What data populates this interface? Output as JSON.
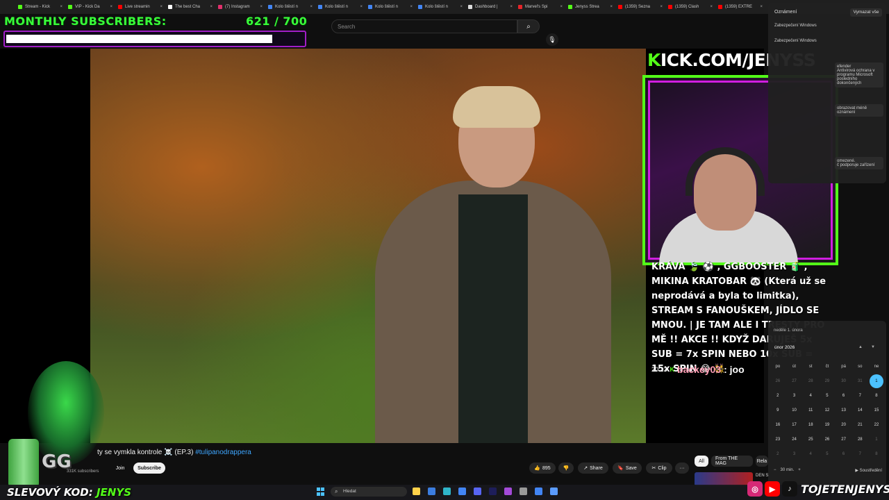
{
  "browser": {
    "tabs": [
      {
        "label": "Stream - Kick",
        "color": "#53fc18"
      },
      {
        "label": "VIP - Kick Da",
        "color": "#53fc18"
      },
      {
        "label": "Live streamin",
        "color": "#ff0000"
      },
      {
        "label": "The best Cha",
        "color": "#ffffff"
      },
      {
        "label": "(7) Instagram",
        "color": "#e1306c"
      },
      {
        "label": "Kolo štěstí n",
        "color": "#4285f4"
      },
      {
        "label": "Kolo štěstí n",
        "color": "#4285f4"
      },
      {
        "label": "Kolo štěstí n",
        "color": "#4285f4"
      },
      {
        "label": "Kolo štěstí n",
        "color": "#4285f4"
      },
      {
        "label": "Dashboard |",
        "color": "#dddddd"
      },
      {
        "label": "Marvel's Spi",
        "color": "#e62429"
      },
      {
        "label": "Jenyss Strea",
        "color": "#53fc18"
      },
      {
        "label": "(1359) Sezna",
        "color": "#ff0000"
      },
      {
        "label": "(1359) Clash",
        "color": "#ff0000"
      },
      {
        "label": "(1359) EXTRE",
        "color": "#ff0000"
      }
    ]
  },
  "youtube": {
    "search_placeholder": "Search",
    "video_title": "ty se vymkla kontrole ☠️ (EP.3)",
    "video_hashtag": "#tulipanodrappera",
    "channel_subscribers": "331K subscribers",
    "join_label": "Join",
    "subscribe_label": "Subscribe",
    "likes": "895",
    "share_label": "Share",
    "save_label": "Save",
    "clip_label": "Clip",
    "more_label": "···",
    "chips": [
      "All",
      "From THE MAG",
      "Rela"
    ],
    "next_video_title": "DEN S"
  },
  "overlay": {
    "goal_label": "MONTHLY SUBSCRIBERS:",
    "goal_count": "621  / 700",
    "goal_progress": 0.887,
    "kick_url_k": "K",
    "kick_url_rest": "ICK.COM/JENYSS",
    "chat_text": "KRÁVA 🍃 ⚽ , GGBOOSTER 🧃 , MIKINA KRATOBAR 🐼 (Která už se neprodává a byla to limitka), STREAM S FANOUŠKEM, JÍDLO SE MNOU. | JE TAM ALE I TRESTY PRO MĚ !! AKCE !! KDYŽ DARUJEŠ 5x SUB = 7x SPIN NEBO 10x SUB = 15x SPIN 😂 👯",
    "chat_time": "20:13",
    "chat_user": "backey03",
    "chat_message": ": joo",
    "promo_label": "SLEVOVÝ KOD: ",
    "promo_code": "JENYS",
    "social_handle": "TOJETENJENYS",
    "badge_text": "GG"
  },
  "notifications": {
    "title": "Oznámení",
    "clear_all": "Vymazat vše",
    "rows": [
      "Zabezpečení Windows",
      "Zabezpečení Windows"
    ],
    "card_defender": "efender\nAntivirová ochrana v programu Microsoft\nposledního\ndokončených",
    "card_less": "obrazovat méně oznámení",
    "card_limited": "omezené.\nč podporuje zařízení"
  },
  "calendar": {
    "day_label": "neděle 1. února",
    "month_label": "únor 2026",
    "weekdays": [
      "po",
      "út",
      "st",
      "čt",
      "pá",
      "so",
      "ne"
    ],
    "days": [
      {
        "d": "26",
        "m": true
      },
      {
        "d": "27",
        "m": true
      },
      {
        "d": "28",
        "m": true
      },
      {
        "d": "29",
        "m": true
      },
      {
        "d": "30",
        "m": true
      },
      {
        "d": "31",
        "m": true
      },
      {
        "d": "1",
        "t": true
      },
      {
        "d": "2"
      },
      {
        "d": "3"
      },
      {
        "d": "4"
      },
      {
        "d": "5"
      },
      {
        "d": "6"
      },
      {
        "d": "7"
      },
      {
        "d": "8"
      },
      {
        "d": "9"
      },
      {
        "d": "10"
      },
      {
        "d": "11"
      },
      {
        "d": "12"
      },
      {
        "d": "13"
      },
      {
        "d": "14"
      },
      {
        "d": "15"
      },
      {
        "d": "16"
      },
      {
        "d": "17"
      },
      {
        "d": "18"
      },
      {
        "d": "19"
      },
      {
        "d": "20"
      },
      {
        "d": "21"
      },
      {
        "d": "22"
      },
      {
        "d": "23"
      },
      {
        "d": "24"
      },
      {
        "d": "25"
      },
      {
        "d": "26"
      },
      {
        "d": "27"
      },
      {
        "d": "28"
      },
      {
        "d": "1",
        "m": true
      },
      {
        "d": "2",
        "m": true
      },
      {
        "d": "3",
        "m": true
      },
      {
        "d": "4",
        "m": true
      },
      {
        "d": "5",
        "m": true
      },
      {
        "d": "6",
        "m": true
      },
      {
        "d": "7",
        "m": true
      },
      {
        "d": "8",
        "m": true
      }
    ],
    "focus_minutes": "30 min.",
    "focus_label": "Soustředění",
    "minus": "−",
    "plus": "+"
  },
  "taskbar": {
    "search_label": "Hledat",
    "icons": [
      "#ffd24a",
      "#3b7de0",
      "#2fb5c9",
      "#4285f4",
      "#5865f2",
      "#1e1e5a",
      "#a34ad8",
      "#999999",
      "#4285f4",
      "#5b9cff"
    ]
  }
}
